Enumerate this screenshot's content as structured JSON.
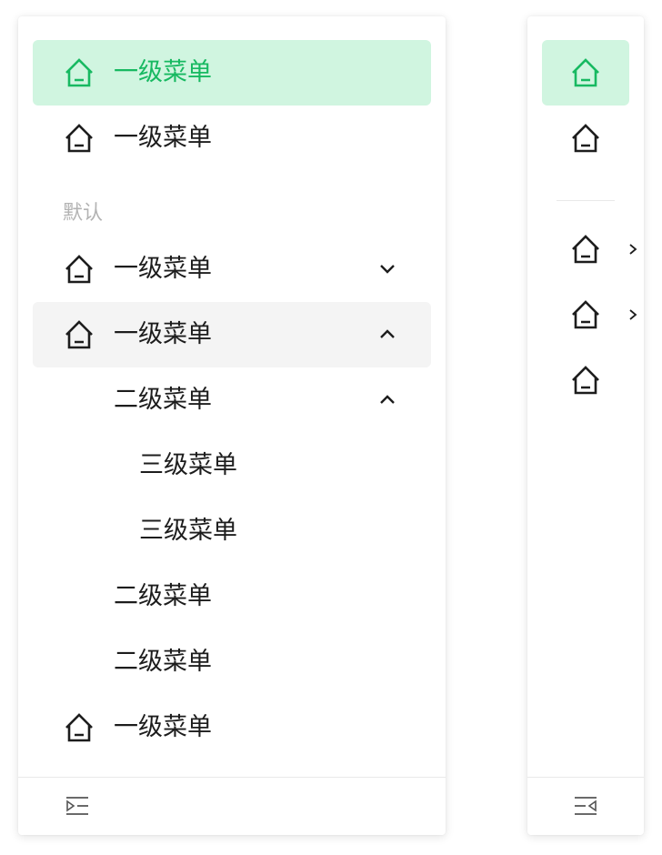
{
  "menu": {
    "items": [
      {
        "label": "一级菜单",
        "icon": "home-icon",
        "state": "active"
      },
      {
        "label": "一级菜单",
        "icon": "home-icon"
      },
      {
        "label": "一级菜单",
        "icon": "home-icon",
        "chevron": "chevron-down-icon"
      },
      {
        "label": "一级菜单",
        "icon": "home-icon",
        "chevron": "chevron-up-icon",
        "state": "hover"
      },
      {
        "label": "一级菜单",
        "icon": "home-icon"
      }
    ],
    "group_title": "默认",
    "sub_items": [
      {
        "label": "二级菜单",
        "chevron": "chevron-up-icon"
      },
      {
        "label": "二级菜单"
      },
      {
        "label": "二级菜单"
      }
    ],
    "third_items": [
      {
        "label": "三级菜单"
      },
      {
        "label": "三级菜单"
      }
    ],
    "footer_icon": "collapse-expand-icon"
  },
  "colors": {
    "active_bg": "#d0f5e0",
    "active_text": "#17b961",
    "hover_bg": "#f4f4f4",
    "text": "#1d1d1d",
    "group_text": "#b3b3b3"
  }
}
